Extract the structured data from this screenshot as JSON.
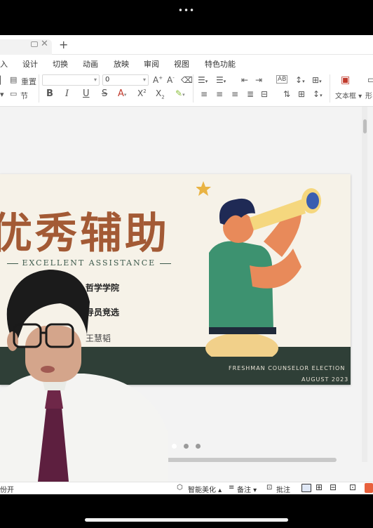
{
  "top_dots": "•••",
  "menu": {
    "items": [
      "入",
      "设计",
      "切换",
      "动画",
      "放映",
      "审阅",
      "视图",
      "特色功能"
    ]
  },
  "toolbar": {
    "redo_label": "重置",
    "section_label": "节",
    "font_size_value": "0",
    "textbox_label": "文本框",
    "shape_label": "形"
  },
  "slide": {
    "title": "优秀辅助",
    "subtitle": "EXCELLENT ASSISTANCE",
    "line1": "哲学学院",
    "line2": "导员竞选",
    "line3": "王慧韬",
    "footer1": "FRESHMAN COUNSELOR ELECTION",
    "footer2": "AUGUST 2023",
    "colors": {
      "title": "#a35a35",
      "band": "#2f3f37",
      "background": "#f6f2e8"
    }
  },
  "statusbar": {
    "left_text": "份开",
    "beautify": "智能美化",
    "notes": "备注",
    "comment": "批注"
  },
  "icons": {
    "tab": "slides-icon",
    "close": "close-icon",
    "add": "plus-icon"
  }
}
